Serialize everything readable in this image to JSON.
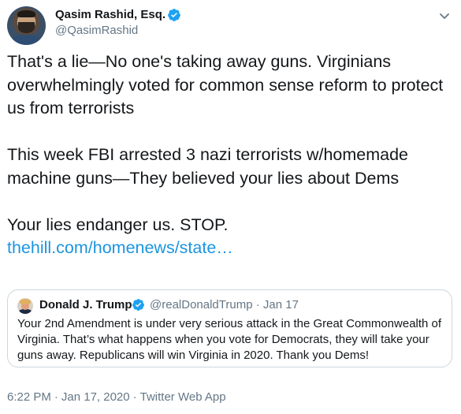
{
  "author": {
    "display_name": "Qasim Rashid, Esq.",
    "handle": "@QasimRashid",
    "verified": true,
    "avatar_icon": "profile-photo"
  },
  "tweet": {
    "paragraphs": [
      "That's a lie—No one's taking away guns. Virginians overwhelmingly voted for common sense reform to protect us from terrorists",
      "This week FBI arrested 3 nazi terrorists w/homemade machine guns—They believed your lies about Dems",
      "Your lies endanger us. STOP."
    ],
    "link_text": "thehill.com/homenews/state…",
    "timestamp": "6:22 PM",
    "date": "Jan 17, 2020",
    "source": "Twitter Web App"
  },
  "quoted_tweet": {
    "display_name": "Donald J. Trump",
    "handle": "@realDonaldTrump",
    "date": "Jan 17",
    "verified": true,
    "text": "Your 2nd Amendment is under very serious attack in the Great Commonwealth of Virginia. That’s what happens when you vote for Democrats, they will take your guns away. Republicans will win Virginia in 2020. Thank you Dems!"
  },
  "colors": {
    "text": "#14171a",
    "secondary": "#657786",
    "link": "#1b95e0",
    "verified": "#1da1f2",
    "border": "#ccd6dd"
  },
  "icons": {
    "verified": "verified-badge-icon",
    "more": "chevron-down-icon"
  }
}
